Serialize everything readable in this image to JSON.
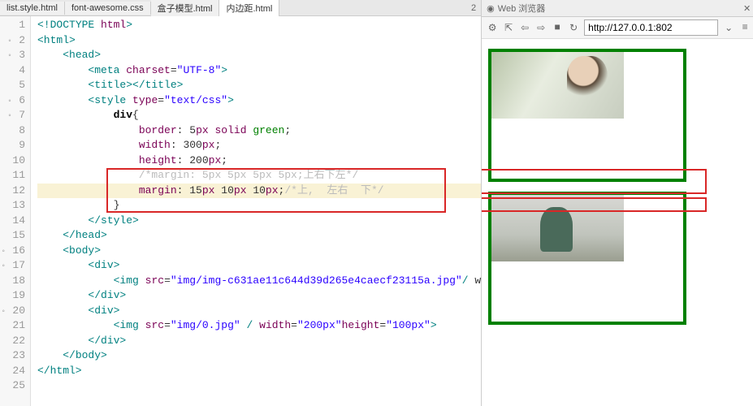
{
  "tabs": [
    {
      "label": "list.style.html"
    },
    {
      "label": "font-awesome.css"
    },
    {
      "label": "盒子模型.html"
    },
    {
      "label": "内边距.html"
    }
  ],
  "pager": "2",
  "lines": [
    "1",
    "2",
    "3",
    "4",
    "5",
    "6",
    "7",
    "8",
    "9",
    "10",
    "11",
    "12",
    "13",
    "14",
    "15",
    "16",
    "17",
    "18",
    "19",
    "20",
    "21",
    "22",
    "23",
    "24",
    "25"
  ],
  "code": {
    "l1": "<!DOCTYPE html>",
    "l2": "<html>",
    "l3_tag": "<head>",
    "l4_tag_open": "<meta",
    "l4_attr": "charset",
    "l4_val": "\"UTF-8\"",
    "l4_close": ">",
    "l5": "<title></title>",
    "l6_open": "<style",
    "l6_attr": "type",
    "l6_val": "\"text/css\"",
    "l6_close": ">",
    "l7_sel": "div",
    "l7_brace": "{",
    "l8_prop": "border",
    "l8_val1": "5",
    "l8_val1u": "px",
    "l8_val2": "solid",
    "l8_val3": "green",
    "l9_prop": "width",
    "l9_val": "300",
    "l9_u": "px",
    "l10_prop": "height",
    "l10_val": "200",
    "l10_u": "px",
    "l11_comment": "/*margin: 5px 5px 5px 5px;上右下左*/",
    "l12_prop": "margin",
    "l12_v1": "15",
    "l12_u1": "px",
    "l12_v2": "10",
    "l12_u2": "px",
    "l12_v3": "10",
    "l12_u3": "px",
    "l12_comment": "/*上,  左右  下*/",
    "l13": "}",
    "l14": "</style>",
    "l15": "</head>",
    "l16": "<body>",
    "l17": "<div>",
    "l18_open": "<img",
    "l18_attr": "src",
    "l18_val": "\"img/img-c631ae11c644d39d265e4caecf23115a.jpg\"",
    "l18_close": "/",
    "l18_tail": " w",
    "l19": "</div>",
    "l20": "<div>",
    "l21_open": "<img",
    "l21_a1": "src",
    "l21_v1": "\"img/0.jpg\"",
    "l21_slash": "/",
    "l21_a2": "width",
    "l21_v2": "\"200px\"",
    "l21_a3": "height",
    "l21_v3": "\"100px\"",
    "l21_close": ">",
    "l22": "</div>",
    "l23": "</body>",
    "l24": "</html>"
  },
  "browser": {
    "title": "Web 浏览器",
    "url": "http://127.0.0.1:802",
    "icons": {
      "gear": "⚙",
      "ext": "⇱",
      "back": "⇦",
      "fwd": "⇨",
      "stop": "■",
      "reload": "↻",
      "dd": "⌄",
      "menu": "≡"
    }
  }
}
